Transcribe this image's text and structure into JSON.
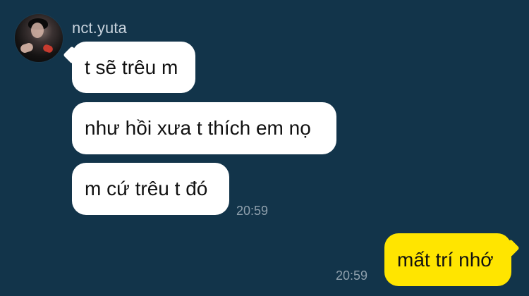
{
  "chat": {
    "sender": "nct.yuta",
    "messages": [
      {
        "text": "t sẽ trêu m"
      },
      {
        "text": "như hồi xưa t thích em nọ"
      },
      {
        "text": "m cứ trêu t đó"
      }
    ],
    "incoming_time": "20:59",
    "outgoing": {
      "text": "mất trí nhớ",
      "time": "20:59"
    }
  },
  "colors": {
    "background": "#12344a",
    "incoming_bubble": "#ffffff",
    "outgoing_bubble": "#ffe500",
    "sender_text": "#c7d2dc",
    "timestamp_text": "#8fa0ad"
  },
  "icons": {
    "avatar": "profile-photo"
  }
}
